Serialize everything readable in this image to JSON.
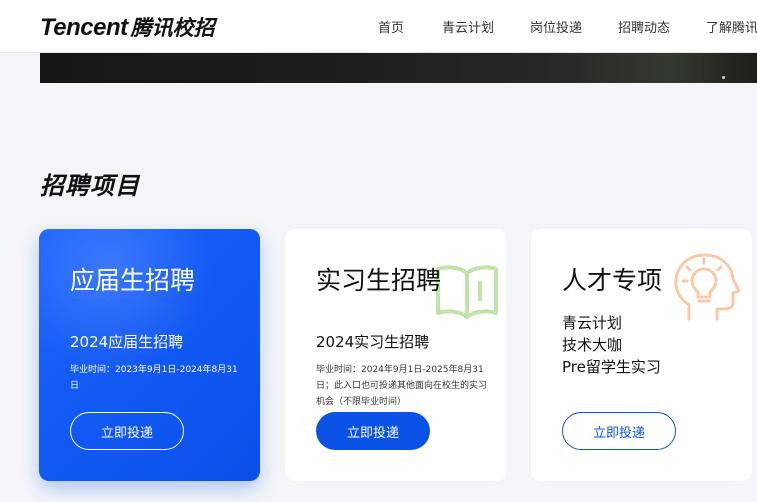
{
  "header": {
    "logo_en": "Tencent",
    "logo_cn": "腾讯校招",
    "nav": [
      {
        "label": "首页"
      },
      {
        "label": "青云计划"
      },
      {
        "label": "岗位投递"
      },
      {
        "label": "招聘动态"
      },
      {
        "label": "了解腾讯"
      }
    ]
  },
  "section": {
    "title": "招聘项目"
  },
  "cards": [
    {
      "title": "应届生招聘",
      "subtitle": "2024应届生招聘",
      "note": "毕业时间：2023年9月1日-2024年8月31日",
      "button": "立即投递",
      "icon": "graduation-icon"
    },
    {
      "title": "实习生招聘",
      "subtitle": "2024实习生招聘",
      "note": "毕业时间：2024年9月1日-2025年8月31日；此入口也可投递其他面向在校生的实习机会（不限毕业时间）",
      "button": "立即投递",
      "icon": "book-icon"
    },
    {
      "title": "人才专项",
      "items": [
        "青云计划",
        "技术大咖",
        "Pre留学生实习"
      ],
      "button": "立即投递",
      "icon": "lightbulb-head-icon"
    }
  ],
  "colors": {
    "brand_blue": "#0a52e6",
    "book_green": "#bfe3a8",
    "bulb_orange": "#f8c8a8"
  }
}
